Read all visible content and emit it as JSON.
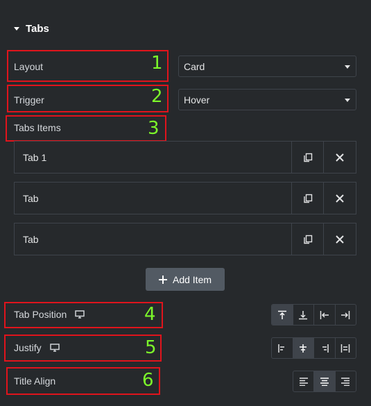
{
  "section": {
    "title": "Tabs"
  },
  "controls": {
    "layout": {
      "label": "Layout",
      "value": "Card",
      "badge": "1"
    },
    "trigger": {
      "label": "Trigger",
      "value": "Hover",
      "badge": "2"
    },
    "tabs_items": {
      "label": "Tabs Items",
      "badge": "3"
    }
  },
  "items": [
    {
      "title": "Tab 1"
    },
    {
      "title": "Tab"
    },
    {
      "title": "Tab"
    }
  ],
  "add_item_label": "Add Item",
  "tab_position": {
    "label": "Tab Position",
    "badge": "4",
    "options": [
      "top",
      "bottom",
      "left",
      "right"
    ],
    "selected": "top"
  },
  "justify": {
    "label": "Justify",
    "badge": "5",
    "options": [
      "start",
      "center",
      "end",
      "stretch"
    ],
    "selected": "center"
  },
  "title_align": {
    "label": "Title Align",
    "badge": "6",
    "options": [
      "left",
      "center",
      "right"
    ],
    "selected": "center"
  },
  "colors": {
    "background": "#26292c",
    "annotation_border": "#e0141c",
    "annotation_number": "#7cf72a"
  }
}
